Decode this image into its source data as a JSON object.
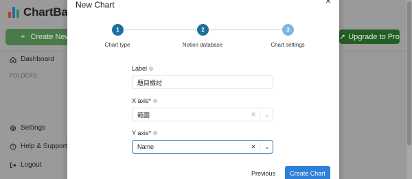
{
  "background": {
    "logo_text": "ChartBase",
    "create_new_label": "Create New C",
    "upgrade_label": "Upgrade to Pro",
    "nav": {
      "dashboard": "Dashboard",
      "folders_heading": "FOLDERS",
      "settings": "Settings",
      "help": "Help & Support",
      "logout": "Logout"
    }
  },
  "modal": {
    "title": "New Chart",
    "steps": [
      {
        "number": "1",
        "label": "Chart type",
        "color": "#1f6fa0"
      },
      {
        "number": "2",
        "label": "Notion database",
        "color": "#1f6fa0"
      },
      {
        "number": "3",
        "label": "Chart settings",
        "color": "#7fb6e0"
      }
    ],
    "fields": {
      "label": {
        "label": "Label",
        "value": "題目檢討"
      },
      "x_axis": {
        "label": "X axis*",
        "value": "範圍"
      },
      "y_axis": {
        "label": "Y axis*",
        "value": "Name"
      }
    },
    "buttons": {
      "previous": "Previous",
      "create": "Create Chart"
    }
  },
  "colors": {
    "primary": "#2f80d6",
    "upgrade": "#245e24"
  }
}
